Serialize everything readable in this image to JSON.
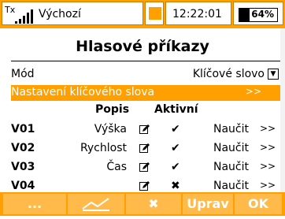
{
  "status": {
    "tx_label": "Tx",
    "profile": "Výchozí",
    "time": "12:22:01",
    "battery_pct": "64%",
    "battery_level": 0.64
  },
  "screen": {
    "title": "Hlasové příkazy",
    "mode_label": "Mód",
    "mode_value": "Klíčové slovo",
    "keyword_settings_label": "Nastavení klíčového slova",
    "keyword_settings_arrow": ">>"
  },
  "table": {
    "col_description": "Popis",
    "col_active": "Aktivní",
    "rows": [
      {
        "id": "V01",
        "name": "Výška",
        "active": "✔",
        "learn": "Naučit",
        "more": ">>"
      },
      {
        "id": "V02",
        "name": "Rychlost",
        "active": "✔",
        "learn": "Naučit",
        "more": ">>"
      },
      {
        "id": "V03",
        "name": "Čas",
        "active": "✔",
        "learn": "Naučit",
        "more": ">>"
      },
      {
        "id": "V04",
        "name": "",
        "active": "✖",
        "learn": "Naučit",
        "more": ">>"
      }
    ]
  },
  "buttons": {
    "b1": "...",
    "b3": "✖",
    "b4": "Uprav",
    "b5": "OK"
  },
  "icons": [
    "signal-bars-icon",
    "pencil-icon",
    "check-icon",
    "cross-icon",
    "chart-icon",
    "dropdown-icon"
  ],
  "colors": {
    "accent": "#ffa000",
    "button": "#ffba4a",
    "text_on_accent": "#ffffff"
  }
}
